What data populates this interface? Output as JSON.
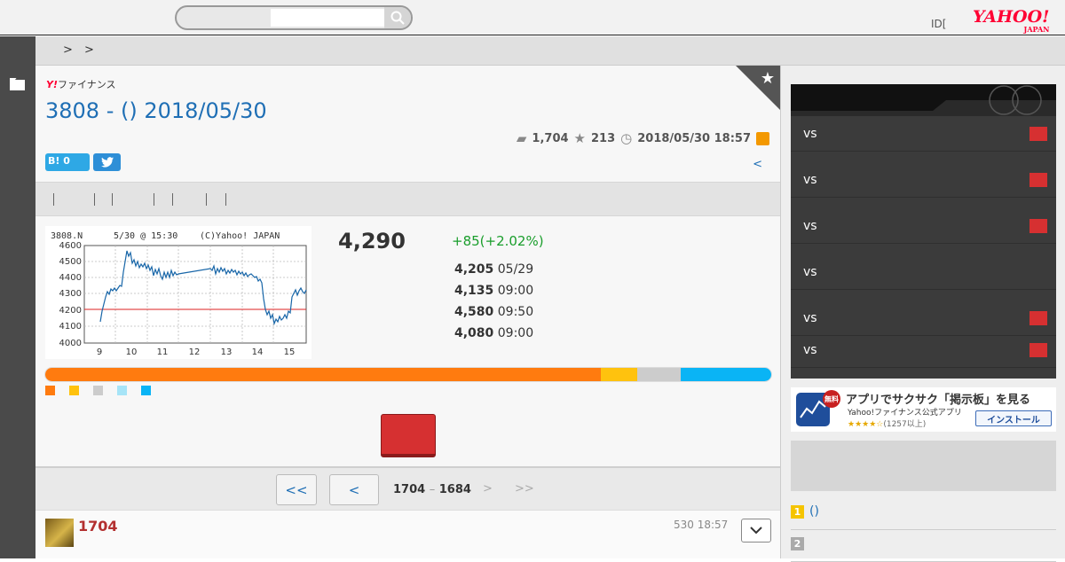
{
  "header": {
    "search_placeholder": "",
    "id_link": "ID[",
    "logo_main": "YAHOO!",
    "logo_sub": "JAPAN"
  },
  "breadcrumb": {
    "sep1": ">",
    "sep2": ">"
  },
  "thread": {
    "brand_y": "Y!",
    "brand_name": "ファイナンス",
    "title": "3808 - () 2018/05/30",
    "comments": "1,704",
    "stars": "213",
    "datetime": "2018/05/30 18:57",
    "hatena_label": "B! 0",
    "twitter_icon": "twitter-icon",
    "back_label": "<"
  },
  "stock": {
    "price": "4,290",
    "change": "+85(+2.02%)",
    "details": [
      {
        "value": "4,205",
        "time": "05/29"
      },
      {
        "value": "4,135",
        "time": "09:00"
      },
      {
        "value": "4,580",
        "time": "09:50"
      },
      {
        "value": "4,080",
        "time": "09:00"
      }
    ],
    "chart": {
      "ticker": "3808.N",
      "stamp": "5/30 @ 15:30",
      "copyright": "(C)Yahoo! JAPAN",
      "y_ticks": [
        "4600",
        "4500",
        "4400",
        "4300",
        "4200",
        "4100",
        "4000"
      ],
      "x_ticks": [
        "9",
        "10",
        "11",
        "12",
        "13",
        "14",
        "15"
      ]
    }
  },
  "sentiment": {
    "segments": [
      {
        "color": "#ff7b0f",
        "share": 0.765
      },
      {
        "color": "#ffc20e",
        "share": 0.05
      },
      {
        "color": "#cccccc",
        "share": 0.06
      },
      {
        "color": "#0ab4f5",
        "share": 0.125
      }
    ],
    "legend_colors": [
      "#ff7b0f",
      "#ffc20e",
      "#cccccc",
      "#a6e4f7",
      "#0ab4f5"
    ]
  },
  "pager": {
    "first": "<<",
    "prev": "<",
    "range_start": "1704",
    "range_dash": "–",
    "range_end": "1684",
    "next": ">",
    "last": ">>"
  },
  "comment": {
    "number": "1704",
    "date": "530 18:57"
  },
  "sidebar": {
    "vs_label": "vs",
    "app_new": "無料",
    "app_title": "アプリでサクサク「掲示板」を見る",
    "app_sub": "Yahoo!ファイナンス公式アプリ",
    "app_stars": "★★★★☆",
    "app_reviews": "(1257以上)",
    "app_install": "インストール",
    "ranks": [
      {
        "num": "1",
        "text": "()",
        "color": "#f5c400"
      },
      {
        "num": "2",
        "text": "",
        "color": "#aaaaaa"
      }
    ]
  }
}
